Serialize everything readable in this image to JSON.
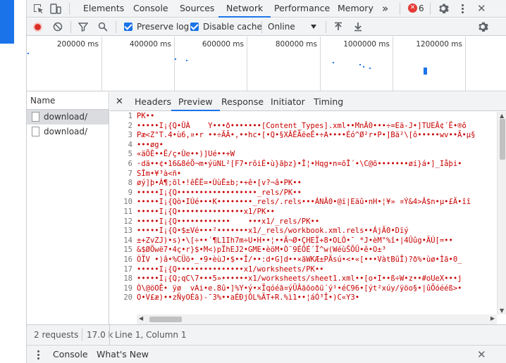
{
  "tabbar": {
    "tabs": [
      "Elements",
      "Console",
      "Sources",
      "Network",
      "Performance",
      "Memory"
    ],
    "active_tab": "Network",
    "more_glyph": "»",
    "error_count": "6",
    "icons": [
      "inspect-element-icon",
      "device-toolbar-icon",
      "more-tabs-icon",
      "error-icon",
      "gear-icon",
      "kebab-menu-icon",
      "close-icon"
    ]
  },
  "toolbar": {
    "preserve_log_label": "Preserve log",
    "preserve_log_checked": true,
    "disable_cache_label": "Disable cache",
    "disable_cache_checked": true,
    "throttle_value": "Online",
    "icons": [
      "record-icon",
      "clear-icon",
      "filter-icon",
      "search-icon",
      "import-icon",
      "export-icon",
      "network-settings-icon"
    ]
  },
  "overview": {
    "ticks": [
      "200000 ms",
      "400000 ms",
      "600000 ms",
      "800000 ms",
      "1000000 ms",
      "1200000 ms"
    ]
  },
  "request_list": {
    "header": "Name",
    "rows": [
      "download/",
      "download/"
    ]
  },
  "detail": {
    "tabs": [
      "Headers",
      "Preview",
      "Response",
      "Initiator",
      "Timing"
    ],
    "active_tab": "Preview",
    "lines": [
      {
        "n": "1",
        "t": "PK••"
      },
      {
        "n": "2",
        "t": "•••••I¡{Q•ÛÀ    Y•••ð•••••••[Content_Types].xml••MnÂ0•••÷=Eä-J•]TUEÂ¢´Ë•®ô"
      },
      {
        "n": "3",
        "t": "Pæ<Z°T.4•ù6,¤•r ••÷ÃÃ•,••hc•[•Q•§XÂÊÃëeÊ•÷A••••Éó^Ø²r•P•]Bä²\\[ô•••••wv••Ã•µ§"
      },
      {
        "n": "4",
        "t": "•••øg•"
      },
      {
        "n": "5",
        "t": "«äÖÈ••Ë/ç•Ùe••)]Ué••+W"
      },
      {
        "n": "6",
        "t": "·dä••¢•16&8éÕ¬m•ýüNL²[F7•rôiÉ•ù}ãþz}•Î¦•Hqg•n=õÎ´•\\C@õ•••••••øí}á•]_Iåþi•"
      },
      {
        "n": "7",
        "t": "SÎm•¥³à<ñ•"
      },
      {
        "n": "8",
        "t": "øý]þ•Á¶;õl•!êËË=•ÙùÊ±b;•+ê•[v?¬â•PK••"
      },
      {
        "n": "9",
        "t": "•••••I¡{Q••••••••••••••••••_rels/PK••"
      },
      {
        "n": "10",
        "t": "•••••I¡{Qò•IÚé•••K••••••••_rels/.rels•••ÁNÂ0•@ï|Eäû•nH•¦¥» ¤Ý&4>Â$n•µ•£Ä•îî"
      },
      {
        "n": "11",
        "t": "•••••I¡{Q•••••••••••••••x1/PK••"
      },
      {
        "n": "12",
        "t": "•••••I¡{Q••••••••••••    •••x1/_rels/PK••"
      },
      {
        "n": "13",
        "t": "•••••I¡{Q•$±Vé•••²•••••••x1/_rels/workbook.xml.rels••ÁjÃ0•Dïý"
      },
      {
        "n": "14",
        "t": "±+ZvZJ)•s)•\\[÷••´¶L1Ih7m÷U•H••¦••Ä¬Ø•ÇHEÏ+8•OLÔ•¯ *J•èM°%î•|4Ûûg•ÄÚ[=••"
      },
      {
        "n": "15",
        "t": "&$ØÕwë7•4ç•r}$•M<)pÏhEJ2•GME•èöM•Ò¨9ÉÕÉ´Ï^w(WéùŠÕÜ•ê•O±³"
      },
      {
        "n": "16",
        "t": "ÒÏV •)â•%CÜö•_•9•èùJ•$••Î/••:d•G]d••×ãWKÆ±PÄsú•<•«[•••VàtBûÎ)?ð%•ùø•Ìã•0_"
      },
      {
        "n": "17",
        "t": "•••••I¡{Q•••••••••••••••x1/worksheets/PK••"
      },
      {
        "n": "18",
        "t": "•••••I¡{Q;qC\\7•••5»••••••x1/worksheets/sheet1.xml••[o•I••ß÷W•z••#oUeX•••j"
      },
      {
        "n": "19",
        "t": "Ò\\@öOÊ• ÿø  vAi•e.8û•]%Y•ý•×Ïqóéã¤ýÜÂãõoðü´ý¹•éC96•[ýt²xúy/ÿöo§•|ûÖóééß>•"
      },
      {
        "n": "20",
        "t": "O•V£æ)••zÑyOÉã)-¯3%••aÉÐjÔL%ÃT+R.%ì1••¦áÓ³Î•)C«Y3•"
      }
    ]
  },
  "statusbar": {
    "requests": "2 requests",
    "transferred": "17.0 k",
    "cursor": "Line 1, Column 1"
  },
  "drawer": {
    "tabs": [
      "Console",
      "What's New"
    ]
  }
}
